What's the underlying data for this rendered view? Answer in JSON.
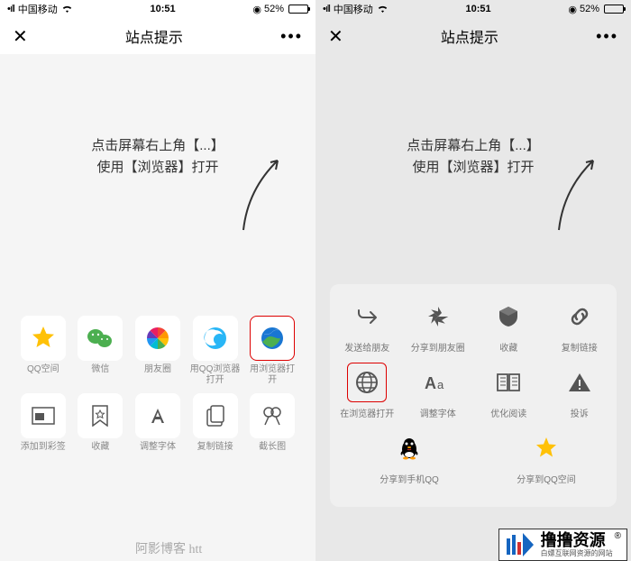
{
  "status": {
    "carrier": "中国移动",
    "time": "10:51",
    "battery_pct": "52%"
  },
  "nav": {
    "close": "✕",
    "title": "站点提示",
    "more": "•••"
  },
  "hint": {
    "line1": "点击屏幕右上角【...】",
    "line2": "使用【浏览器】打开"
  },
  "left_sheet": {
    "row1": [
      {
        "label": "QQ空间",
        "icon": "qzone"
      },
      {
        "label": "微信",
        "icon": "wechat"
      },
      {
        "label": "朋友圈",
        "icon": "moments"
      },
      {
        "label": "用QQ浏览器打开",
        "icon": "qqbrowser"
      },
      {
        "label": "用浏览器打开",
        "icon": "browser",
        "highlight": true
      }
    ],
    "row2": [
      {
        "label": "添加到彩签",
        "icon": "tag"
      },
      {
        "label": "收藏",
        "icon": "bookmark"
      },
      {
        "label": "调整字体",
        "icon": "font"
      },
      {
        "label": "复制链接",
        "icon": "copy"
      },
      {
        "label": "截长图",
        "icon": "screenshot"
      }
    ]
  },
  "right_sheet": {
    "row1": [
      {
        "label": "发送给朋友",
        "icon": "share"
      },
      {
        "label": "分享到朋友圈",
        "icon": "aperture"
      },
      {
        "label": "收藏",
        "icon": "cube"
      },
      {
        "label": "复制链接",
        "icon": "link"
      }
    ],
    "row2": [
      {
        "label": "在浏览器打开",
        "icon": "globe",
        "highlight": true
      },
      {
        "label": "调整字体",
        "icon": "font-aa"
      },
      {
        "label": "优化阅读",
        "icon": "book"
      },
      {
        "label": "投诉",
        "icon": "warn"
      }
    ],
    "row3": [
      {
        "label": "分享到手机QQ",
        "icon": "qq"
      },
      {
        "label": "分享到QQ空间",
        "icon": "qzone-star"
      }
    ]
  },
  "watermark": {
    "text1": "阿影博客 htt",
    "title": "撸撸资源",
    "sub": "白嫖互联网资源的网站"
  }
}
